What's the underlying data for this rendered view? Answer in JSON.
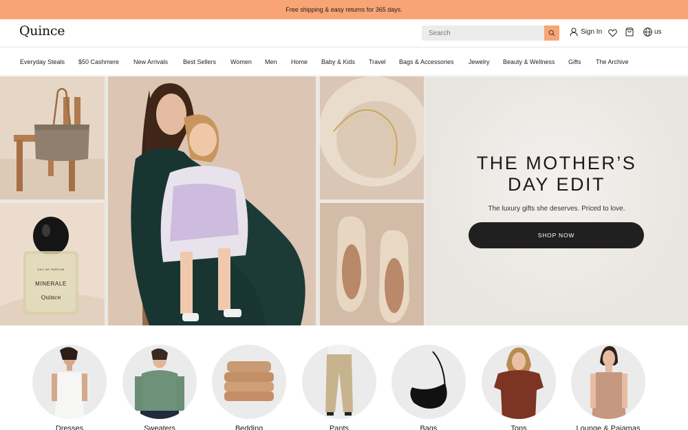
{
  "promo": {
    "text": "Free shipping & easy returns for 365 days."
  },
  "header": {
    "logo": "Quince",
    "search": {
      "placeholder": "Search"
    },
    "sign_in": "Sign In",
    "locale": "us"
  },
  "nav": {
    "items": [
      "Everyday Steals",
      "$50 Cashmere",
      "New Arrivals",
      "Best Sellers",
      "Women",
      "Men",
      "Home",
      "Baby & Kids",
      "Travel",
      "Bags & Accessories",
      "Jewelry",
      "Beauty & Wellness",
      "Gifts",
      "The Archive"
    ]
  },
  "hero": {
    "title_line1": "THE MOTHER’S",
    "title_line2": "DAY EDIT",
    "subtitle": "The luxury gifts she deserves. Priced to love.",
    "cta": "SHOP NOW",
    "perfume_brand": "Quince",
    "perfume_name": "MINERALE",
    "perfume_type": "EAU DE PARFUM"
  },
  "categories": [
    "Dresses",
    "Sweaters",
    "Bedding",
    "Pants",
    "Bags",
    "Tops",
    "Lounge & Pajamas"
  ],
  "colors": {
    "promo": "#f8a475",
    "cta": "#202020",
    "hero_bg": "#ece8e3"
  }
}
